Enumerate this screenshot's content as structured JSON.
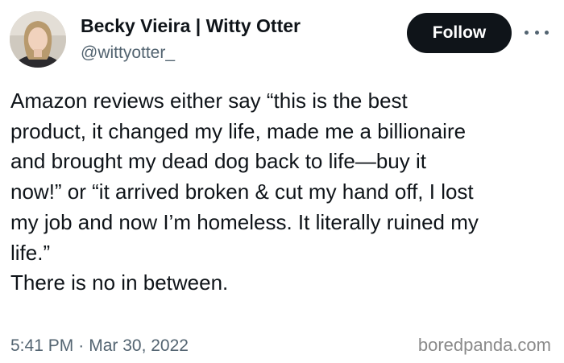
{
  "author": {
    "display_name": "Becky Vieira | Witty Otter",
    "handle": "@wittyotter_"
  },
  "actions": {
    "follow_label": "Follow",
    "more_icon": "more-horizontal-icon"
  },
  "tweet": {
    "lines": [
      "Amazon reviews either say “this is the best",
      "product, it changed my life, made me a billionaire",
      "and brought my dead dog back to life—buy it",
      "now!” or “it arrived broken & cut my hand off, I lost",
      "my job and now I’m homeless. It literally ruined my",
      "life.”",
      "There is no in between."
    ],
    "time": "5:41 PM",
    "separator": "·",
    "date": "Mar 30, 2022"
  },
  "watermark": "boredpanda.com",
  "colors": {
    "text_primary": "#0f1419",
    "text_secondary": "#536471",
    "follow_bg": "#0f1419",
    "follow_text": "#ffffff"
  }
}
